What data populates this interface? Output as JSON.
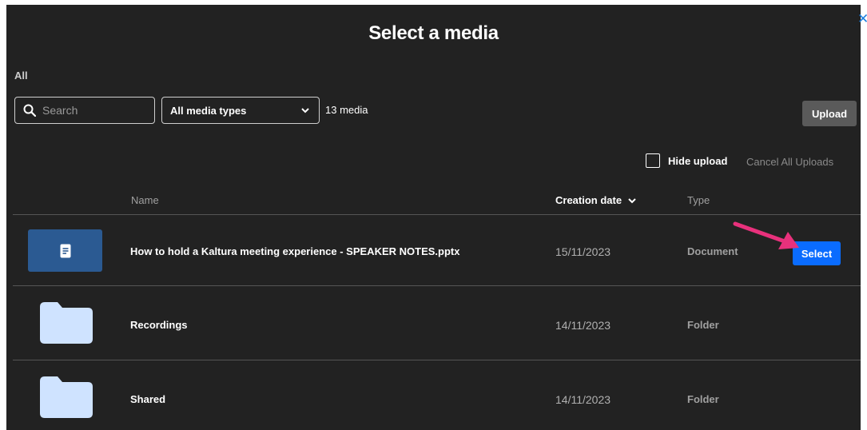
{
  "dialog": {
    "title": "Select a media",
    "close_icon": "close-icon"
  },
  "breadcrumb": "All",
  "toolbar": {
    "search_placeholder": "Search",
    "media_type_selected": "All media types",
    "media_count": "13 media",
    "upload_label": "Upload"
  },
  "upload_options": {
    "hide_upload_label": "Hide upload",
    "hide_upload_checked": false,
    "cancel_all_label": "Cancel All Uploads"
  },
  "table": {
    "columns": [
      "Name",
      "Creation date",
      "Type"
    ],
    "sort_indicator": "⌄",
    "rows": [
      {
        "name": "How to hold a Kaltura meeting experience - SPEAKER NOTES.pptx",
        "date": "15/11/2023",
        "type": "Document",
        "icon": "document-icon",
        "select_label": "Select"
      },
      {
        "name": "Recordings",
        "date": "14/11/2023",
        "type": "Folder",
        "icon": "folder-icon"
      },
      {
        "name": "Shared",
        "date": "14/11/2023",
        "type": "Folder",
        "icon": "folder-icon"
      }
    ]
  },
  "colors": {
    "background": "#222222",
    "accent": "#0a6cff",
    "document_thumb": "#2b5a92",
    "folder": "#cfe3ff",
    "arrow": "#e8317c"
  }
}
